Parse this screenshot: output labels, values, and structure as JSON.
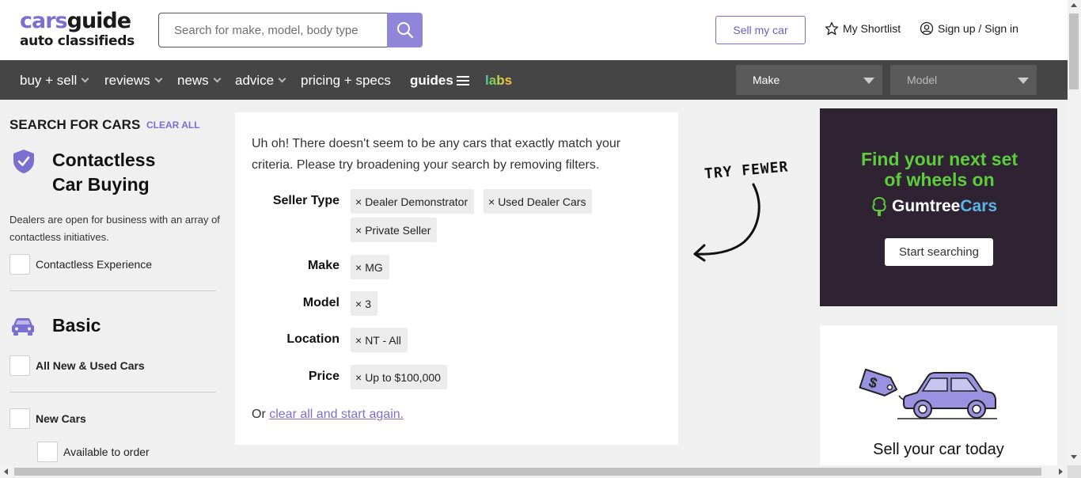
{
  "header": {
    "logo_cars": "cars",
    "logo_guide": "guide",
    "logo_sub": "auto classifieds",
    "search_placeholder": "Search for make, model, body type",
    "sell_label": "Sell my car",
    "shortlist_label": "My Shortlist",
    "signin_label": "Sign up / Sign in"
  },
  "nav": {
    "items": [
      {
        "label": "buy + sell"
      },
      {
        "label": "reviews"
      },
      {
        "label": "news"
      },
      {
        "label": "advice"
      },
      {
        "label": "pricing + specs"
      },
      {
        "label": "guides"
      },
      {
        "label": "labs"
      }
    ],
    "make_label": "Make",
    "model_label": "Model"
  },
  "sidebar": {
    "title": "SEARCH FOR CARS",
    "clear_all": "CLEAR ALL",
    "contactless": {
      "heading_line1": "Contactless",
      "heading_line2": "Car Buying",
      "description": "Dealers are open for business with an array of contactless initiatives.",
      "option": "Contactless Experience"
    },
    "basic": {
      "heading": "Basic",
      "options": [
        "All New & Used Cars",
        "New Cars"
      ],
      "sub_option": "Available to order"
    }
  },
  "results": {
    "message": "Uh oh! There doesn't seem to be any cars that exactly match your criteria. Please try broadening your search by removing filters.",
    "filters": [
      {
        "label": "Seller Type",
        "chips": [
          "Dealer Demonstrator",
          "Used Dealer Cars",
          "Private Seller"
        ]
      },
      {
        "label": "Make",
        "chips": [
          "MG"
        ]
      },
      {
        "label": "Model",
        "chips": [
          "3"
        ]
      },
      {
        "label": "Location",
        "chips": [
          "NT - All"
        ]
      },
      {
        "label": "Price",
        "chips": [
          "Up to $100,000"
        ]
      }
    ],
    "chip_remove_symbol": "×",
    "or_text": "Or ",
    "clear_link": "clear all and start again."
  },
  "hint": {
    "text": "TRY FEWER"
  },
  "ads": {
    "gumtree": {
      "headline": "Find your next set of wheels on",
      "brand_1": "Gumtree",
      "brand_2": "Cars",
      "button": "Start searching",
      "colors": {
        "background": "#2f2232",
        "headline": "#5cce3b",
        "brand_accent": "#5ab6e8"
      }
    },
    "sell": {
      "title": "Sell your car today"
    }
  },
  "colors": {
    "accent": "#7b6fd1",
    "nav_bg": "#454545",
    "page_bg": "#f0f0f0"
  }
}
